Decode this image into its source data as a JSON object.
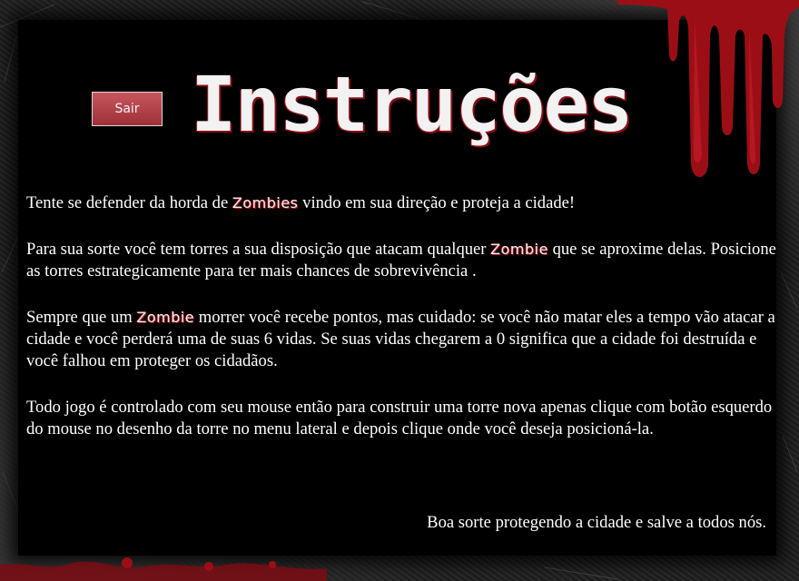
{
  "header": {
    "title": "Instruções",
    "exit_button": "Sair"
  },
  "instructions": [
    {
      "before": "Tente se defender da horda de ",
      "zombie": "Zombies",
      "after": " vindo em sua direção e proteja a cidade!"
    },
    {
      "before": "Para sua sorte você tem torres a sua disposição que atacam qualquer ",
      "zombie": "Zombie",
      "after": " que se aproxime delas. Posicione as torres estrategicamente para ter mais chances de sobrevivência ."
    },
    {
      "before": "Sempre que um ",
      "zombie": "Zombie",
      "after": " morrer você recebe pontos, mas cuidado: se você não matar eles a tempo vão atacar a cidade e você perderá uma de suas 6 vidas. Se suas vidas chegarem a 0 significa que a cidade foi destruída e você falhou em proteger os cidadãos."
    },
    {
      "before": "Todo jogo é controlado com seu mouse então para construir uma torre nova apenas clique com botão esquerdo do mouse no desenho da torre no menu lateral e depois clique onde você deseja posicioná-la.",
      "zombie": "",
      "after": ""
    }
  ],
  "closing": "Boa sorte protegendo a cidade e salve a todos nós.",
  "colors": {
    "blood": "#b31620",
    "button": "#b8434c",
    "panel": "#000000",
    "frame": "#2a2a2a"
  }
}
